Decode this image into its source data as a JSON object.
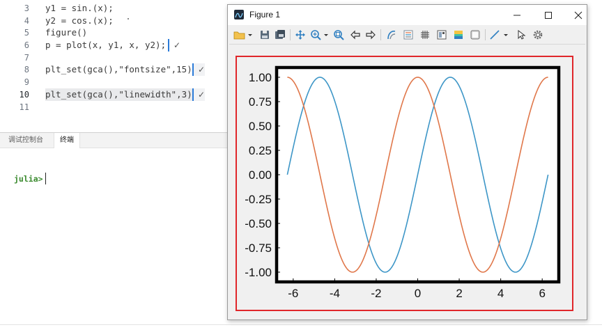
{
  "editor": {
    "lines": [
      {
        "num": "3",
        "code": "y1 = sin.(x);"
      },
      {
        "num": "4",
        "code": "y2 = cos.(x);"
      },
      {
        "num": "5",
        "code": "figure()"
      },
      {
        "num": "6",
        "code": "p = plot(x, y1, x, y2);",
        "check": "✓"
      },
      {
        "num": "7",
        "code": ""
      },
      {
        "num": "8",
        "code": "plt_set(gca(),\"fontsize\",15)",
        "check": "✓"
      },
      {
        "num": "9",
        "code": ""
      },
      {
        "num": "10",
        "code": "plt_set(gca(),\"linewidth\",3)",
        "check": "✓"
      },
      {
        "num": "11",
        "code": ""
      }
    ]
  },
  "panel": {
    "tabs": [
      "调试控制台",
      "终端"
    ],
    "active_tab": "终端",
    "prompt": "julia>"
  },
  "figure_window": {
    "title": "Figure 1",
    "minimize": "–",
    "maximize": "□",
    "close": "✕",
    "toolbar_icons": [
      "open-folder-icon",
      "save-icon",
      "save-all-icon",
      "pan-icon",
      "zoom-in-icon",
      "zoom-reset-icon",
      "back-arrow-icon",
      "forward-arrow-icon",
      "rotate-icon",
      "legend-icon",
      "grid-icon",
      "colorbar-icon",
      "color-icon",
      "box-icon",
      "line-tool-icon",
      "select-arrow-icon",
      "settings-gear-icon"
    ]
  },
  "chart_data": {
    "type": "line",
    "title": "",
    "xlabel": "",
    "ylabel": "",
    "xlim": [
      -6.8,
      6.8
    ],
    "ylim": [
      -1.1,
      1.1
    ],
    "xticks": [
      "-6",
      "-4",
      "-2",
      "0",
      "2",
      "4",
      "6"
    ],
    "xtick_values": [
      -6,
      -4,
      -2,
      0,
      2,
      4,
      6
    ],
    "yticks": [
      "1.00",
      "0.75",
      "0.50",
      "0.25",
      "0.00",
      "-0.25",
      "-0.50",
      "-0.75",
      "-1.00"
    ],
    "ytick_values": [
      1.0,
      0.75,
      0.5,
      0.25,
      0.0,
      -0.25,
      -0.5,
      -0.75,
      -1.0
    ],
    "x_range": [
      -6.2832,
      6.2832
    ],
    "series": [
      {
        "function": "sin",
        "color": "#3d96c7",
        "x": [
          -6.28,
          -4.71,
          -3.14,
          -1.57,
          0,
          1.57,
          3.14,
          4.71,
          6.28
        ],
        "values": [
          0,
          1,
          0,
          -1,
          0,
          1,
          0,
          -1,
          0
        ]
      },
      {
        "function": "cos",
        "color": "#e0774a",
        "x": [
          -6.28,
          -4.71,
          -3.14,
          -1.57,
          0,
          1.57,
          3.14,
          4.71,
          6.28
        ],
        "values": [
          1,
          0,
          -1,
          0,
          1,
          0,
          -1,
          0,
          1
        ]
      }
    ],
    "grid": false,
    "frame_color": "#000000",
    "frame_linewidth": 3,
    "font_size": 15
  },
  "colors": {
    "accent_blue": "#2b7bd9",
    "highlight_red": "#e0262a",
    "prompt_green": "#3a8a2e"
  }
}
